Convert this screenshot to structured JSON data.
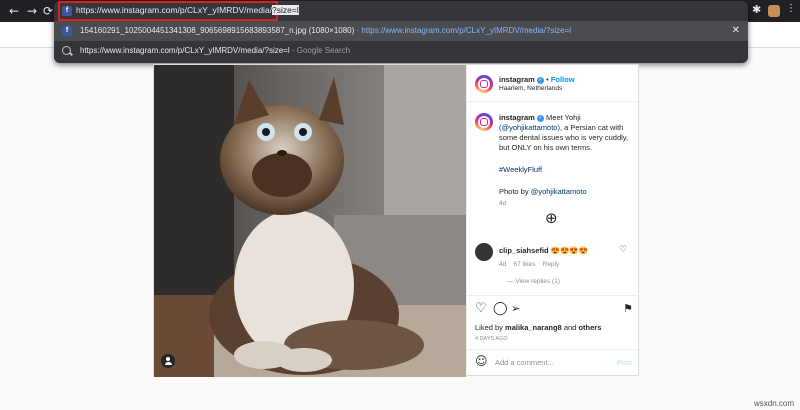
{
  "browser": {
    "url": "https://www.instagram.com/p/CLxY_yIMRDV/media/?size=l",
    "url_selected_part": "?size=l",
    "suggestions": [
      {
        "title": "154160291_1025004451341308_9065698915683893587_n.jpg (1080×1080)",
        "separator": " - ",
        "link": "https://www.instagram.com/p/CLxY_yIMRDV/media/?size=l"
      },
      {
        "query": "https://www.instagram.com/p/CLxY_yIMRDV/media/?size=l",
        "suffix": " - Google Search"
      }
    ],
    "back_icon": "←",
    "forward_icon": "→",
    "reload_icon": "⟳",
    "close_icon": "✕",
    "extensions_icon": "✱",
    "favicon_letter": "f"
  },
  "post": {
    "username": "instagram",
    "follow_label": "Follow",
    "location": "Haarlem, Netherlands",
    "caption_user": "instagram",
    "caption_p1": "Meet Yohji",
    "caption_mention": "(@yohjikattamoto)",
    "caption_p2": ", a Persian cat with some dental issues who is very cuddly, but ONLY on his own terms.",
    "hashtag": "#WeeklyFluff",
    "photo_by": "Photo by",
    "photo_by_user": "@yohjikattamoto",
    "caption_age": "4d",
    "comment_user": "clip_siahsefid",
    "comment_text": "😍😍😍😍",
    "comment_age": "4d",
    "comment_likes": "67 likes",
    "comment_reply": "Reply",
    "view_replies": "View replies (1)",
    "liked_by_prefix": "Liked by",
    "liked_by_user": "malika_narang8",
    "liked_by_suffix": "and",
    "liked_by_others": "others",
    "post_age": "4 DAYS AGO",
    "add_comment_placeholder": "Add a comment...",
    "post_label": "Post",
    "emoji_icon": "☺",
    "plus_icon": "⊕",
    "heart_icon": "♡",
    "comment_icon": "◯",
    "share_icon": "➢",
    "bookmark_icon": "⚑"
  },
  "watermark": "wsxdn.com"
}
